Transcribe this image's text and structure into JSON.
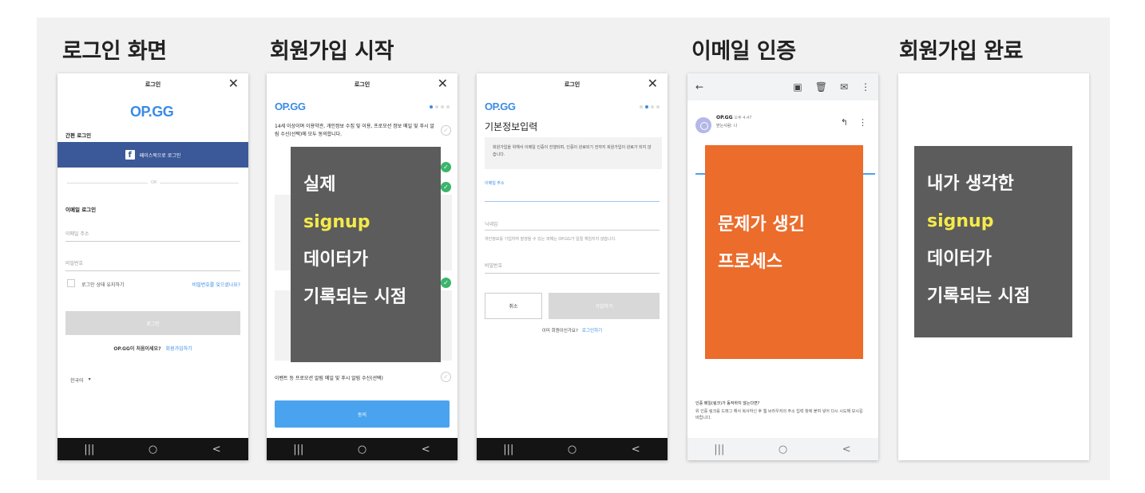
{
  "titles": [
    "로그인 화면",
    "회원가입 시작",
    "이메일 인증",
    "회원가입 완료"
  ],
  "navbar": {
    "recent": "|||",
    "home": "○",
    "back": "<"
  },
  "login": {
    "header": "로그인",
    "close": "✕",
    "logo": "OP.GG",
    "simple_login": "간편 로그인",
    "facebook_icon": "f",
    "facebook_button": "페이스북으로 로그인",
    "divider": "OR",
    "email_login": "이메일 로그인",
    "email_placeholder": "이메일 주소",
    "password_placeholder": "비밀번호",
    "keep_logged_in": "로그인 상태 유지하기",
    "forgot_password": "비밀번호를 잊으셨나요?",
    "login_button": "로그인",
    "signup_prompt": "OP.GG이 처음이세요?",
    "signup_link": "회원가입하기",
    "language": "한국어",
    "language_arrow": "▾"
  },
  "signup_start": {
    "header": "로그인",
    "close": "✕",
    "logo": "OP.GG",
    "agree_all": "14세 이상이며 이용약관, 개인정보 수집 및 이용, 프로모션 정보 메일 및 푸시 알림 수신(선택)에 모두 동의합니다.",
    "promo": "이벤트 등 프로모션 알림 메일 및 푸시 알림 수신(선택)",
    "agree_button": "동의",
    "check_mark": "✓",
    "overlay": [
      "실제",
      "signup",
      "데이터가",
      "기록되는 시점"
    ]
  },
  "basic_info": {
    "header": "로그인",
    "close": "✕",
    "logo": "OP.GG",
    "title": "기본정보입력",
    "notice": "회원가입을 위해서 이메일 인증이 진행되며, 인증이 완료되기 전까지 회원가입이 완료가 되지 않습니다.",
    "email_label": "이메일 주소",
    "nickname_label": "닉네임",
    "nickname_help": "개인정보를 기입하여 발생될 수 있는 피해는 OP.GG가 일절 책임지지 않습니다.",
    "password_label": "비밀번호",
    "cancel_button": "취소",
    "submit_button": "가입하기",
    "login_prompt": "이미 회원이신가요?",
    "login_link": "로그인하기"
  },
  "email_verify": {
    "toolbar_back": "←",
    "toolbar_icons": [
      "▣",
      "🗑",
      "✉",
      "⋮"
    ],
    "sender": "OP.GG",
    "sent_time": "오후 4:47",
    "recipient": "받는사람: 나",
    "reply": "↰",
    "more": "⋮",
    "overlay": [
      "문제가 생긴",
      "프로세스"
    ],
    "footer_title": "인증 메일(링크)가 동작하지 않는다면?",
    "footer_body": "위 인증 링크를 드래그 해서 복사하신 후 웹 브라우저의 주소 입력 창에 붙여 넣어 다시 시도해 보시길 바랍니다."
  },
  "complete": {
    "overlay": [
      "내가 생각한",
      "signup",
      "데이터가",
      "기록되는 시점"
    ]
  },
  "colors": {
    "overlay_gray": "#5c5c5c",
    "overlay_orange": "#eb6c2b",
    "highlight_yellow": "#f5ea4a",
    "opgg_blue": "#3a8be6",
    "facebook_blue": "#3b5998"
  }
}
